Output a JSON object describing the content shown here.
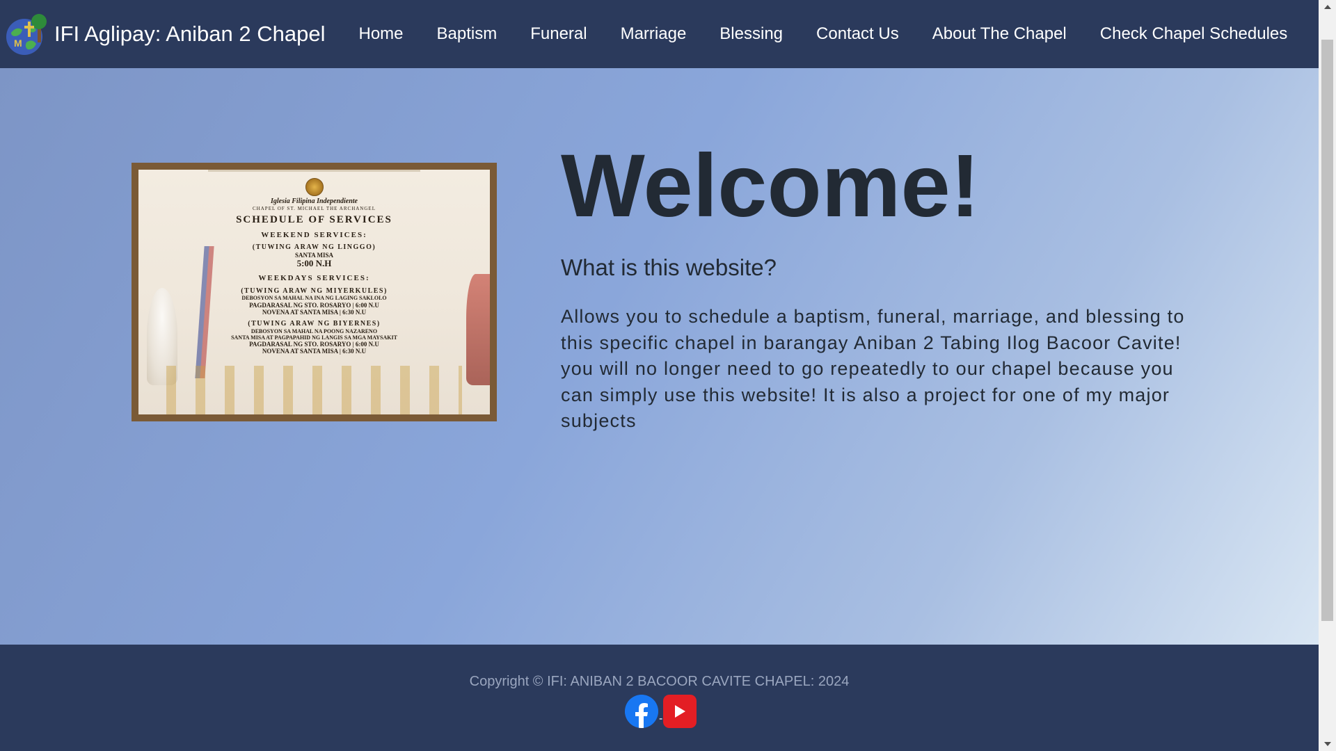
{
  "nav": {
    "brand": "IFI Aglipay: Aniban 2 Chapel",
    "logo_icon": "chapel-logo-icon",
    "links": [
      "Home",
      "Baptism",
      "Funeral",
      "Marriage",
      "Blessing",
      "Contact Us",
      "About The Chapel",
      "Check Chapel Schedules"
    ]
  },
  "hero": {
    "heading": "Welcome!",
    "subheading": "What is this website?",
    "description": "Allows you to schedule a baptism, funeral, marriage, and blessing to this specific chapel in barangay Aniban 2 Tabing Ilog Bacoor Cavite! you will no longer need to go repeatedly to our chapel because you can simply use this website! It is also a project for one of my major subjects"
  },
  "poster": {
    "line1": "Iglesia Filipina Independiente",
    "line2": "CHAPEL OF ST. MICHAEL THE ARCHANGEL",
    "title": "SCHEDULE OF SERVICES",
    "weekend_header": "WEEKEND SERVICES:",
    "weekend_day": "(TUWING ARAW NG LINGGO)",
    "weekend_mass": "SANTA MISA",
    "weekend_time": "5:00 N.H",
    "weekdays_header": "WEEKDAYS SERVICES:",
    "wed_day": "(TUWING ARAW NG MIYERKULES)",
    "wed_1": "DEBOSYON SA MAHAL NA INA NG LAGING SAKLOLO",
    "wed_2": "PAGDARASAL NG STO. ROSARYO | 6:00 N.U",
    "wed_3": "NOVENA AT SANTA MISA | 6:30 N.U",
    "fri_day": "(TUWING ARAW NG BIYERNES)",
    "fri_1": "DEBOSYON SA MAHAL NA POONG NAZARENO",
    "fri_2": "SANTA MISA AT PAGPAPAHID NG LANGIS SA MGA MAYSAKIT",
    "fri_3": "PAGDARASAL NG STO. ROSARYO | 6:00 N.U",
    "fri_4": "NOVENA AT SANTA MISA | 6:30 N.U"
  },
  "footer": {
    "copyright": "Copyright © IFI: ANIBAN 2 BACOOR CAVITE CHAPEL: 2024",
    "separator": "-",
    "icons": [
      "facebook-icon",
      "youtube-icon"
    ]
  },
  "colors": {
    "nav_bg": "#2b3a5c",
    "footer_bg": "#2b3a5c",
    "text_dark": "#222a34",
    "facebook": "#1877f2",
    "youtube": "#e31e24"
  }
}
